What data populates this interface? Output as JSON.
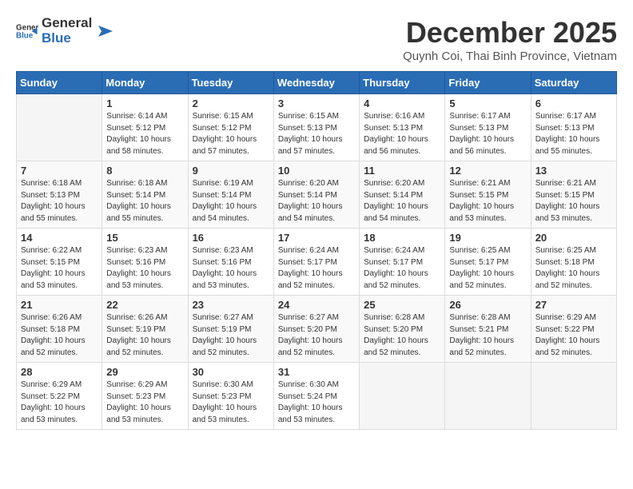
{
  "header": {
    "logo_general": "General",
    "logo_blue": "Blue",
    "month": "December 2025",
    "location": "Quynh Coi, Thai Binh Province, Vietnam"
  },
  "weekdays": [
    "Sunday",
    "Monday",
    "Tuesday",
    "Wednesday",
    "Thursday",
    "Friday",
    "Saturday"
  ],
  "weeks": [
    [
      {
        "day": "",
        "sunrise": "",
        "sunset": "",
        "daylight": ""
      },
      {
        "day": "1",
        "sunrise": "Sunrise: 6:14 AM",
        "sunset": "Sunset: 5:12 PM",
        "daylight": "Daylight: 10 hours and 58 minutes."
      },
      {
        "day": "2",
        "sunrise": "Sunrise: 6:15 AM",
        "sunset": "Sunset: 5:12 PM",
        "daylight": "Daylight: 10 hours and 57 minutes."
      },
      {
        "day": "3",
        "sunrise": "Sunrise: 6:15 AM",
        "sunset": "Sunset: 5:13 PM",
        "daylight": "Daylight: 10 hours and 57 minutes."
      },
      {
        "day": "4",
        "sunrise": "Sunrise: 6:16 AM",
        "sunset": "Sunset: 5:13 PM",
        "daylight": "Daylight: 10 hours and 56 minutes."
      },
      {
        "day": "5",
        "sunrise": "Sunrise: 6:17 AM",
        "sunset": "Sunset: 5:13 PM",
        "daylight": "Daylight: 10 hours and 56 minutes."
      },
      {
        "day": "6",
        "sunrise": "Sunrise: 6:17 AM",
        "sunset": "Sunset: 5:13 PM",
        "daylight": "Daylight: 10 hours and 55 minutes."
      }
    ],
    [
      {
        "day": "7",
        "sunrise": "Sunrise: 6:18 AM",
        "sunset": "Sunset: 5:13 PM",
        "daylight": "Daylight: 10 hours and 55 minutes."
      },
      {
        "day": "8",
        "sunrise": "Sunrise: 6:18 AM",
        "sunset": "Sunset: 5:14 PM",
        "daylight": "Daylight: 10 hours and 55 minutes."
      },
      {
        "day": "9",
        "sunrise": "Sunrise: 6:19 AM",
        "sunset": "Sunset: 5:14 PM",
        "daylight": "Daylight: 10 hours and 54 minutes."
      },
      {
        "day": "10",
        "sunrise": "Sunrise: 6:20 AM",
        "sunset": "Sunset: 5:14 PM",
        "daylight": "Daylight: 10 hours and 54 minutes."
      },
      {
        "day": "11",
        "sunrise": "Sunrise: 6:20 AM",
        "sunset": "Sunset: 5:14 PM",
        "daylight": "Daylight: 10 hours and 54 minutes."
      },
      {
        "day": "12",
        "sunrise": "Sunrise: 6:21 AM",
        "sunset": "Sunset: 5:15 PM",
        "daylight": "Daylight: 10 hours and 53 minutes."
      },
      {
        "day": "13",
        "sunrise": "Sunrise: 6:21 AM",
        "sunset": "Sunset: 5:15 PM",
        "daylight": "Daylight: 10 hours and 53 minutes."
      }
    ],
    [
      {
        "day": "14",
        "sunrise": "Sunrise: 6:22 AM",
        "sunset": "Sunset: 5:15 PM",
        "daylight": "Daylight: 10 hours and 53 minutes."
      },
      {
        "day": "15",
        "sunrise": "Sunrise: 6:23 AM",
        "sunset": "Sunset: 5:16 PM",
        "daylight": "Daylight: 10 hours and 53 minutes."
      },
      {
        "day": "16",
        "sunrise": "Sunrise: 6:23 AM",
        "sunset": "Sunset: 5:16 PM",
        "daylight": "Daylight: 10 hours and 53 minutes."
      },
      {
        "day": "17",
        "sunrise": "Sunrise: 6:24 AM",
        "sunset": "Sunset: 5:17 PM",
        "daylight": "Daylight: 10 hours and 52 minutes."
      },
      {
        "day": "18",
        "sunrise": "Sunrise: 6:24 AM",
        "sunset": "Sunset: 5:17 PM",
        "daylight": "Daylight: 10 hours and 52 minutes."
      },
      {
        "day": "19",
        "sunrise": "Sunrise: 6:25 AM",
        "sunset": "Sunset: 5:17 PM",
        "daylight": "Daylight: 10 hours and 52 minutes."
      },
      {
        "day": "20",
        "sunrise": "Sunrise: 6:25 AM",
        "sunset": "Sunset: 5:18 PM",
        "daylight": "Daylight: 10 hours and 52 minutes."
      }
    ],
    [
      {
        "day": "21",
        "sunrise": "Sunrise: 6:26 AM",
        "sunset": "Sunset: 5:18 PM",
        "daylight": "Daylight: 10 hours and 52 minutes."
      },
      {
        "day": "22",
        "sunrise": "Sunrise: 6:26 AM",
        "sunset": "Sunset: 5:19 PM",
        "daylight": "Daylight: 10 hours and 52 minutes."
      },
      {
        "day": "23",
        "sunrise": "Sunrise: 6:27 AM",
        "sunset": "Sunset: 5:19 PM",
        "daylight": "Daylight: 10 hours and 52 minutes."
      },
      {
        "day": "24",
        "sunrise": "Sunrise: 6:27 AM",
        "sunset": "Sunset: 5:20 PM",
        "daylight": "Daylight: 10 hours and 52 minutes."
      },
      {
        "day": "25",
        "sunrise": "Sunrise: 6:28 AM",
        "sunset": "Sunset: 5:20 PM",
        "daylight": "Daylight: 10 hours and 52 minutes."
      },
      {
        "day": "26",
        "sunrise": "Sunrise: 6:28 AM",
        "sunset": "Sunset: 5:21 PM",
        "daylight": "Daylight: 10 hours and 52 minutes."
      },
      {
        "day": "27",
        "sunrise": "Sunrise: 6:29 AM",
        "sunset": "Sunset: 5:22 PM",
        "daylight": "Daylight: 10 hours and 52 minutes."
      }
    ],
    [
      {
        "day": "28",
        "sunrise": "Sunrise: 6:29 AM",
        "sunset": "Sunset: 5:22 PM",
        "daylight": "Daylight: 10 hours and 53 minutes."
      },
      {
        "day": "29",
        "sunrise": "Sunrise: 6:29 AM",
        "sunset": "Sunset: 5:23 PM",
        "daylight": "Daylight: 10 hours and 53 minutes."
      },
      {
        "day": "30",
        "sunrise": "Sunrise: 6:30 AM",
        "sunset": "Sunset: 5:23 PM",
        "daylight": "Daylight: 10 hours and 53 minutes."
      },
      {
        "day": "31",
        "sunrise": "Sunrise: 6:30 AM",
        "sunset": "Sunset: 5:24 PM",
        "daylight": "Daylight: 10 hours and 53 minutes."
      },
      {
        "day": "",
        "sunrise": "",
        "sunset": "",
        "daylight": ""
      },
      {
        "day": "",
        "sunrise": "",
        "sunset": "",
        "daylight": ""
      },
      {
        "day": "",
        "sunrise": "",
        "sunset": "",
        "daylight": ""
      }
    ]
  ]
}
